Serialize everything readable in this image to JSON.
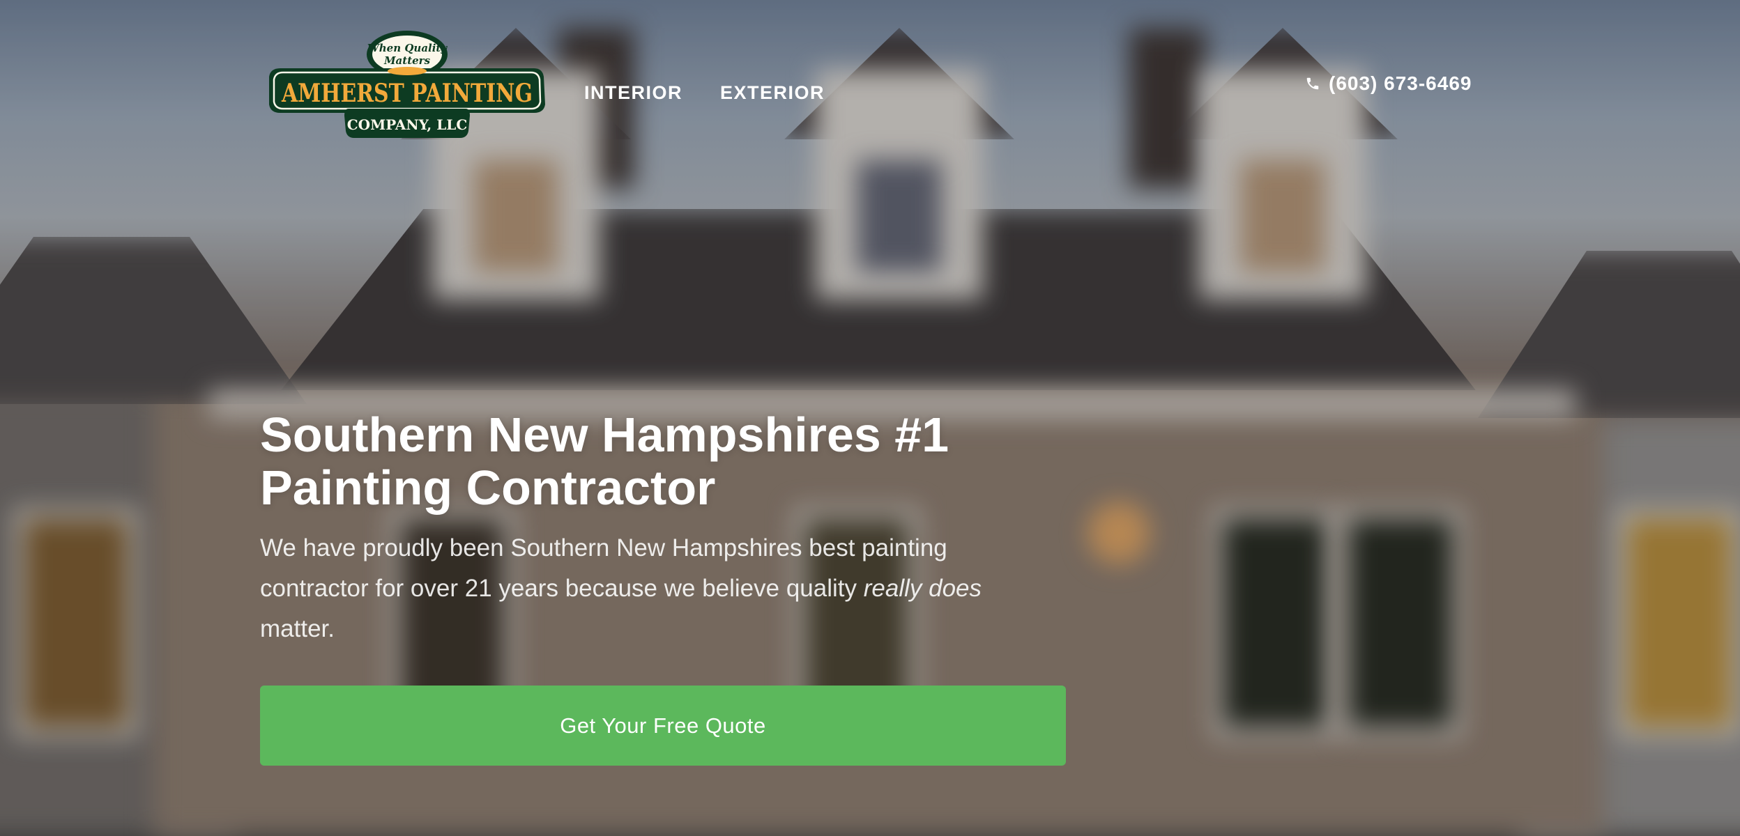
{
  "logo": {
    "tagline_line1": "When Quality",
    "tagline_line2": "Matters",
    "name": "AMHERST PAINTING",
    "subname": "COMPANY, LLC",
    "colors": {
      "green": "#0d3b22",
      "gold": "#f2a93b",
      "cream": "#fbf7ea"
    }
  },
  "nav": {
    "items": [
      {
        "label": "INTERIOR"
      },
      {
        "label": "EXTERIOR"
      }
    ]
  },
  "header": {
    "phone_icon": "phone-icon",
    "phone": "(603) 673-6469"
  },
  "hero": {
    "title_line1": "Southern New Hampshires #1",
    "title_line2": "Painting Contractor",
    "text_before": "We have proudly been Southern New Hampshires best painting contractor for over 21 years because we believe quality ",
    "text_emphasis": "really does",
    "text_after": " matter.",
    "cta_label": "Get Your Free Quote",
    "cta_color": "#5cb85c"
  }
}
